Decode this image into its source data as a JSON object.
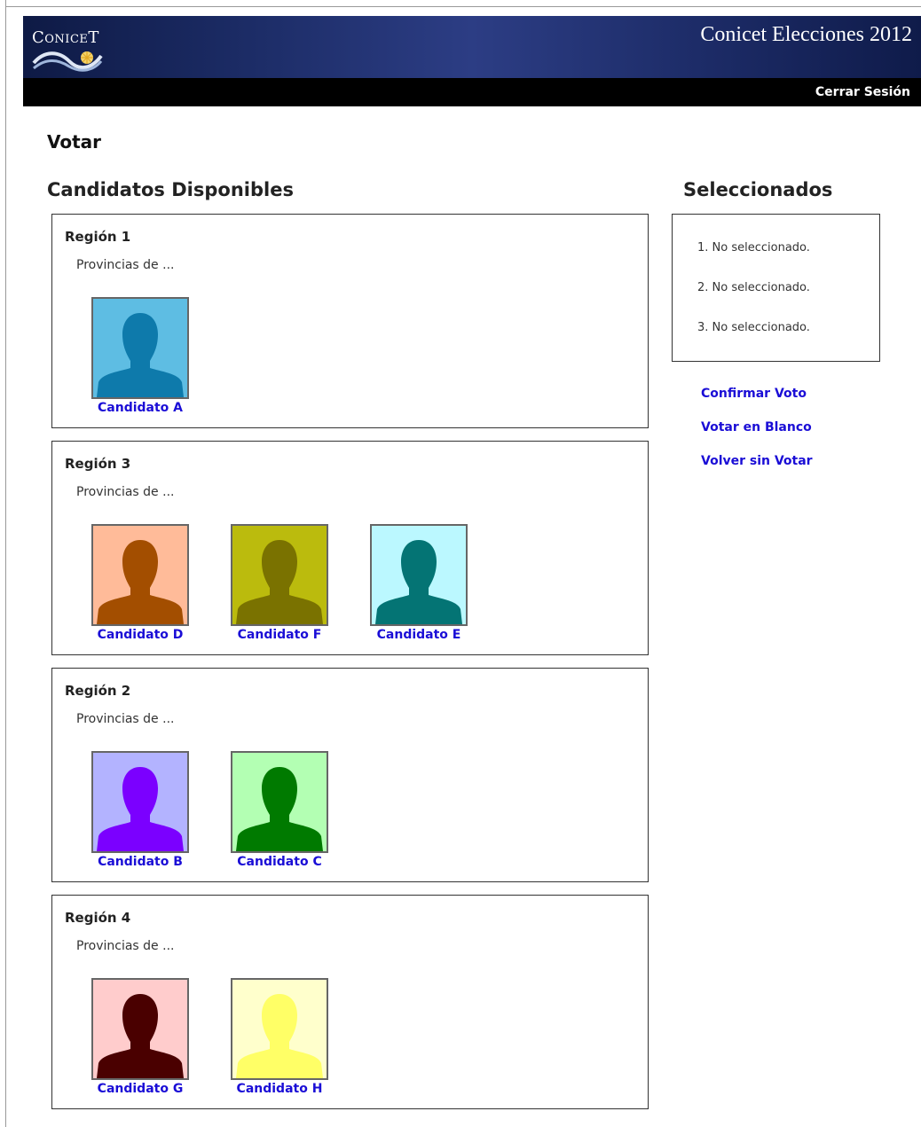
{
  "header": {
    "logo_text": "ConiceT",
    "app_title": "Conicet Elecciones 2012",
    "logout_label": "Cerrar Sesión",
    "bg_color": "#1c2c66"
  },
  "page": {
    "title": "Votar",
    "available_title": "Candidatos Disponibles",
    "selected_title": "Seleccionados"
  },
  "regions": [
    {
      "name": "Región 1",
      "desc": "Provincias de ...",
      "candidates": [
        {
          "name": "Candidato A",
          "bg": "#5ebde3",
          "fg": "#0e7aab"
        }
      ]
    },
    {
      "name": "Región 3",
      "desc": "Provincias de ...",
      "candidates": [
        {
          "name": "Candidato D",
          "bg": "#ffbb99",
          "fg": "#a34e00"
        },
        {
          "name": "Candidato F",
          "bg": "#bbbb0d",
          "fg": "#7a7200"
        },
        {
          "name": "Candidato E",
          "bg": "#bbf8ff",
          "fg": "#047474"
        }
      ]
    },
    {
      "name": "Región 2",
      "desc": "Provincias de ...",
      "candidates": [
        {
          "name": "Candidato B",
          "bg": "#b3b3ff",
          "fg": "#7b00ff"
        },
        {
          "name": "Candidato C",
          "bg": "#b3ffb3",
          "fg": "#007a00"
        }
      ]
    },
    {
      "name": "Región 4",
      "desc": "Provincias de ...",
      "candidates": [
        {
          "name": "Candidato G",
          "bg": "#ffcccc",
          "fg": "#4a0000"
        },
        {
          "name": "Candidato H",
          "bg": "#ffffcc",
          "fg": "#ffff66"
        }
      ]
    }
  ],
  "selected": [
    "1.  No seleccionado.",
    "2.  No seleccionado.",
    "3.  No seleccionado."
  ],
  "actions": {
    "confirm": "Confirmar Voto",
    "blank": "Votar en Blanco",
    "back": "Volver sin Votar"
  },
  "colors": {
    "link": "#1a0dd6"
  }
}
